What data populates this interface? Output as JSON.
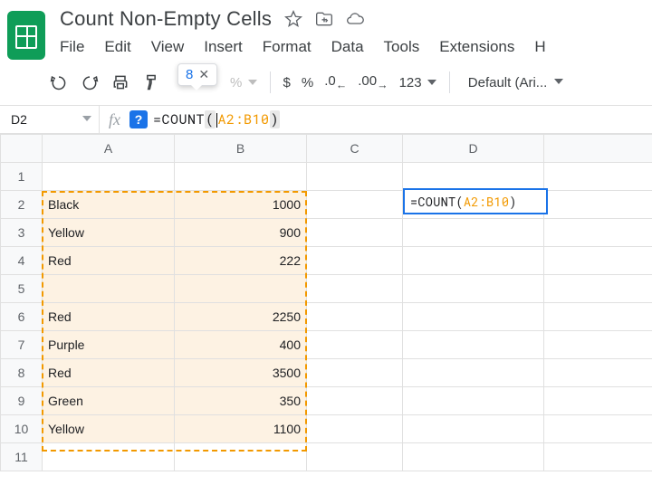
{
  "doc": {
    "title": "Count Non-Empty Cells"
  },
  "menus": {
    "file": "File",
    "edit": "Edit",
    "view": "View",
    "insert": "Insert",
    "format": "Format",
    "data": "Data",
    "tools": "Tools",
    "extensions": "Extensions",
    "help": "H"
  },
  "toolbar": {
    "preview_value": "8",
    "dollar": "$",
    "percent": "%",
    "dec_dec": ".0",
    "dec_inc": ".00",
    "n123": "123",
    "font": "Default (Ari..."
  },
  "nameBox": {
    "value": "D2"
  },
  "formulaBar": {
    "eq": "=",
    "fn": "COUNT",
    "open": "(",
    "range": "A2:B10",
    "close": ")"
  },
  "activeCell": {
    "eq": "=",
    "fn": "COUNT",
    "open": "(",
    "range": "A2:B10",
    "close": ")"
  },
  "columns": {
    "A": "A",
    "B": "B",
    "C": "C",
    "D": "D"
  },
  "rows": {
    "1": "1",
    "2": "2",
    "3": "3",
    "4": "4",
    "5": "5",
    "6": "6",
    "7": "7",
    "8": "8",
    "9": "9",
    "10": "10",
    "11": "11"
  },
  "cells": {
    "A2": "Black",
    "B2": "1000",
    "A3": "Yellow",
    "B3": "900",
    "A4": "Red",
    "B4": "222",
    "A5": "",
    "B5": "",
    "A6": "Red",
    "B6": "2250",
    "A7": "Purple",
    "B7": "400",
    "A8": "Red",
    "B8": "3500",
    "A9": "Green",
    "B9": "350",
    "A10": "Yellow",
    "B10": "1100"
  }
}
